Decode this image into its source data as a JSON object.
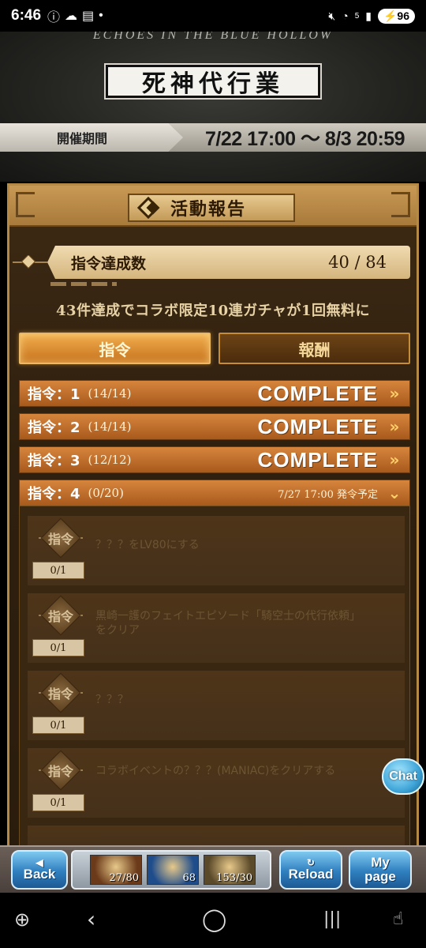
{
  "status_bar": {
    "time": "6:46",
    "battery": "96",
    "signal_label": "5"
  },
  "banner": {
    "subtitle": "ECHOES IN THE BLUE HOLLOW",
    "logo_text": "死神代行業",
    "period_label": "開催期間",
    "period_value": "7/22 17:00 ～ 8/3 20:59"
  },
  "panel": {
    "title": "活動報告",
    "achievement_label": "指令達成数",
    "achievement_value": "40 / 84",
    "notice": "43件達成でコラボ限定10連ガチャが1回無料に",
    "tabs": [
      {
        "label": "指令"
      },
      {
        "label": "報酬"
      }
    ],
    "missions": [
      {
        "name": "指令：1",
        "count": "(14/14)",
        "status": "COMPLETE",
        "chevron": "»"
      },
      {
        "name": "指令：2",
        "count": "(14/14)",
        "status": "COMPLETE",
        "chevron": "»"
      },
      {
        "name": "指令：3",
        "count": "(12/12)",
        "status": "COMPLETE",
        "chevron": "»"
      },
      {
        "name": "指令：4",
        "count": "(0/20)",
        "schedule": "7/27 17:00 発令予定",
        "chevron": "⌄"
      }
    ],
    "tasks": [
      {
        "emblem": "指令",
        "progress": "0/1",
        "text": "？？？をLV80にする"
      },
      {
        "emblem": "指令",
        "progress": "0/1",
        "text": "黒崎一護のフェイトエピソード「騎空士の代行依頼」をクリア"
      },
      {
        "emblem": "指令",
        "progress": "0/1",
        "text": "？？？"
      },
      {
        "emblem": "指令",
        "progress": "0/1",
        "text": "コラボイベントの？？？(MANIAC)をクリアする"
      }
    ]
  },
  "chat": {
    "label": "Chat"
  },
  "gamebar": {
    "back": {
      "label": "Back",
      "icon": "◀"
    },
    "resources": [
      {
        "value": "27/80",
        "color": "#6b3a1a"
      },
      {
        "value": "68",
        "color": "#1f4d8c"
      },
      {
        "value": "153/30",
        "color": "#5b4a2a"
      }
    ],
    "reload": {
      "label": "Reload",
      "icon": "↻"
    },
    "mypage": {
      "label": "My page"
    }
  }
}
